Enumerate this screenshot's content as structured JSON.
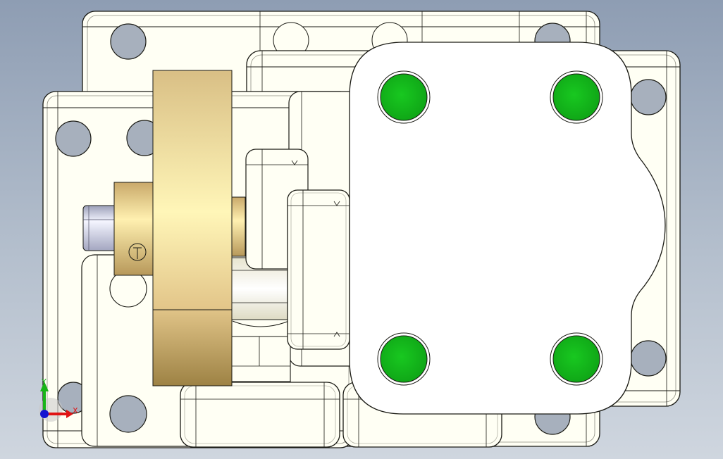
{
  "viewport": {
    "background_top": "#8e9db3",
    "background_bottom": "#cfd6df",
    "body_color": "#fffff4",
    "edge_color": "#1a1a14",
    "bolt_color": "#12b51a",
    "brass_light": "#fff3b0",
    "brass_dark": "#a5884a"
  },
  "triad": {
    "x_label": "X",
    "y_label": "Y",
    "x_color": "#e01414",
    "y_color": "#18b418",
    "z_color": "#1414d0"
  }
}
